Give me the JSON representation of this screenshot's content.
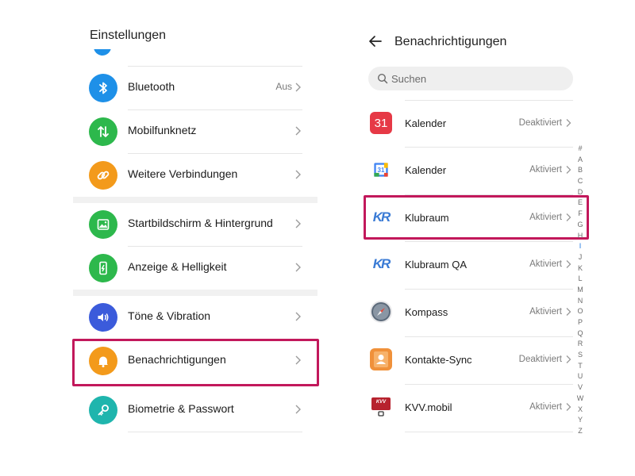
{
  "left_panel": {
    "title": "Einstellungen",
    "items": [
      {
        "label": "Bluetooth",
        "value": "Aus",
        "icon": "bluetooth-icon",
        "color": "#1e90e8"
      },
      {
        "label": "Mobilfunknetz",
        "value": "",
        "icon": "mobile-data-icon",
        "color": "#2db84c"
      },
      {
        "label": "Weitere Verbindungen",
        "value": "",
        "icon": "link-icon",
        "color": "#f39a1b"
      },
      {
        "label": "Startbildschirm & Hintergrund",
        "value": "",
        "icon": "wallpaper-icon",
        "color": "#2db84c"
      },
      {
        "label": "Anzeige & Helligkeit",
        "value": "",
        "icon": "display-brightness-icon",
        "color": "#2db84c"
      },
      {
        "label": "Töne & Vibration",
        "value": "",
        "icon": "speaker-icon",
        "color": "#3b5bdb"
      },
      {
        "label": "Benachrichtigungen",
        "value": "",
        "icon": "bell-icon",
        "color": "#f39a1b"
      },
      {
        "label": "Biometrie & Passwort",
        "value": "",
        "icon": "key-icon",
        "color": "#1fb5ad"
      }
    ]
  },
  "right_panel": {
    "title": "Benachrichtigungen",
    "search_placeholder": "Suchen",
    "apps": [
      {
        "label": "Kalender",
        "status": "Deaktiviert",
        "icon": "calendar-red-icon",
        "icon_text": "31"
      },
      {
        "label": "Kalender",
        "status": "Aktiviert",
        "icon": "google-calendar-icon",
        "icon_text": "31"
      },
      {
        "label": "Klubraum",
        "status": "Aktiviert",
        "icon": "klubraum-icon",
        "icon_text": "KR"
      },
      {
        "label": "Klubraum QA",
        "status": "Aktiviert",
        "icon": "klubraum-qa-icon",
        "icon_text": "KR"
      },
      {
        "label": "Kompass",
        "status": "Aktiviert",
        "icon": "compass-icon"
      },
      {
        "label": "Kontakte-Sync",
        "status": "Deaktiviert",
        "icon": "contacts-icon"
      },
      {
        "label": "KVV.mobil",
        "status": "Aktiviert",
        "icon": "kvv-mobil-icon",
        "icon_text": "KVV"
      }
    ],
    "alphabet": [
      "#",
      "A",
      "B",
      "C",
      "D",
      "E",
      "F",
      "G",
      "H",
      "I",
      "J",
      "K",
      "L",
      "M",
      "N",
      "O",
      "P",
      "Q",
      "R",
      "S",
      "T",
      "U",
      "V",
      "W",
      "X",
      "Y",
      "Z"
    ],
    "alphabet_active": "I"
  },
  "colors": {
    "highlight": "#c2185b",
    "accent_blue": "#1e78e0"
  }
}
